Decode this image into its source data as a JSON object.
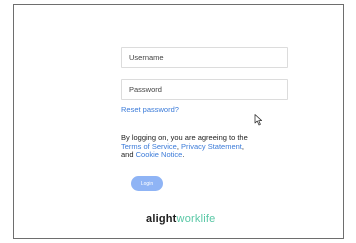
{
  "login_form": {
    "username": {
      "value": "",
      "placeholder": "Username"
    },
    "password": {
      "value": "",
      "placeholder": "Password"
    },
    "reset_password_link": "Reset password?",
    "terms": {
      "prefix": "By logging on, you are agreeing to the",
      "terms_of_service": "Terms of Service",
      "sep1": ", ",
      "privacy_statement": "Privacy Statement",
      "sep2": ",",
      "and_text": "and ",
      "cookie_notice": "Cookie Notice",
      "suffix": "."
    },
    "login_button": "Login"
  },
  "brand": {
    "name_part1": "alight",
    "name_part2": "worklife",
    "colors": {
      "dark": "#1d1d1d",
      "accent": "#58c7a5",
      "link": "#3b7bd9",
      "button": "#8fb4f5"
    }
  },
  "pointer": {
    "icon": "arrow-cursor-icon"
  }
}
